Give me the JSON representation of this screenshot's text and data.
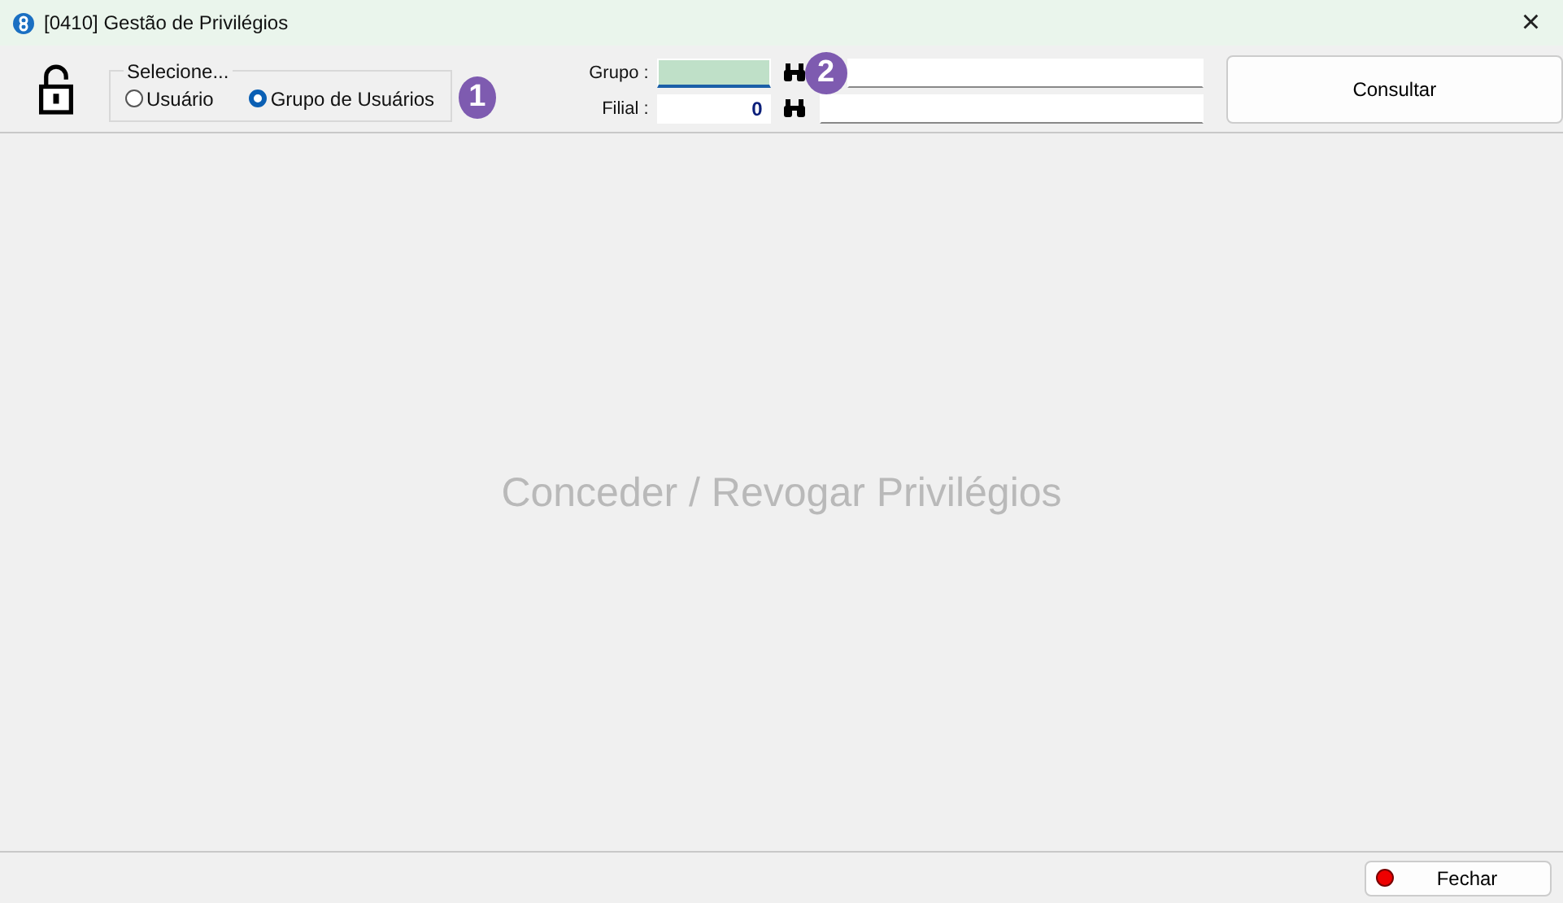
{
  "window": {
    "title": "[0410] Gestão de Privilégios",
    "close": "×"
  },
  "selection": {
    "legend": "Selecione...",
    "options": [
      {
        "label": "Usuário",
        "selected": false
      },
      {
        "label": "Grupo de Usuários",
        "selected": true
      }
    ],
    "badge": "1"
  },
  "fields": [
    {
      "label": "Grupo :",
      "focused": true,
      "badge": "2"
    },
    {
      "label": "Filial :",
      "value": "0",
      "focused": false
    }
  ],
  "query_button": "Consultar",
  "placeholder_text": "Conceder / Revogar Privilégios",
  "close_button": "Fechar"
}
